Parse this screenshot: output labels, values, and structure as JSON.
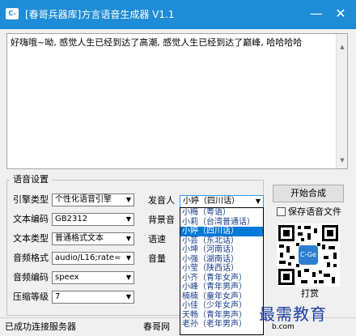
{
  "window": {
    "title": "[春哥兵器库]方言语音生成器 V1.1",
    "icon_text": "C-Ge",
    "minimize_glyph": "—",
    "close_glyph": "✕"
  },
  "editor": {
    "text": "好嗨哦~呦, 感觉人生已经到达了高潮, 感觉人生已经到达了巅峰, 哈哈哈哈"
  },
  "settings": {
    "group_title": "语音设置",
    "engine_type": {
      "label": "引擎类型",
      "value": "个性化语音引擎"
    },
    "text_encoding": {
      "label": "文本编码",
      "value": "GB2312"
    },
    "text_type": {
      "label": "文本类型",
      "value": "普通格式文本"
    },
    "audio_format": {
      "label": "音频格式",
      "value": "audio/L16;rate="
    },
    "audio_encoding": {
      "label": "音频编码",
      "value": "speex"
    },
    "compression_level": {
      "label": "压缩等级",
      "value": "7"
    },
    "speaker": {
      "label": "发音人",
      "value": "小婷（四川话）"
    },
    "background_sound": {
      "label": "背景音"
    },
    "speed": {
      "label": "语速"
    },
    "volume": {
      "label": "音量"
    }
  },
  "speaker_options": [
    "小梅（粤语）",
    "小莉（台湾普通话）",
    "小婷（四川话）",
    "小芸（东北话）",
    "小坤（河南话）",
    "小强（湖南话）",
    "小莹（陕西话）",
    "小齐（青年女声）",
    "小峰（青年男声）",
    "楠楠（童年女声）",
    "小佳（少年女声）",
    "天畅（青年男声）",
    "老孙（老年男声）"
  ],
  "speaker_selected_index": 2,
  "actions": {
    "start_button": "开始合成",
    "save_checkbox_label": "保存语音文件"
  },
  "qr": {
    "center_text": "C-Ge",
    "caption": "打赏"
  },
  "status": {
    "left": "已成功连接服务器",
    "right": "春哥网",
    "right_tail": "b.com"
  },
  "watermark": "最需教育"
}
